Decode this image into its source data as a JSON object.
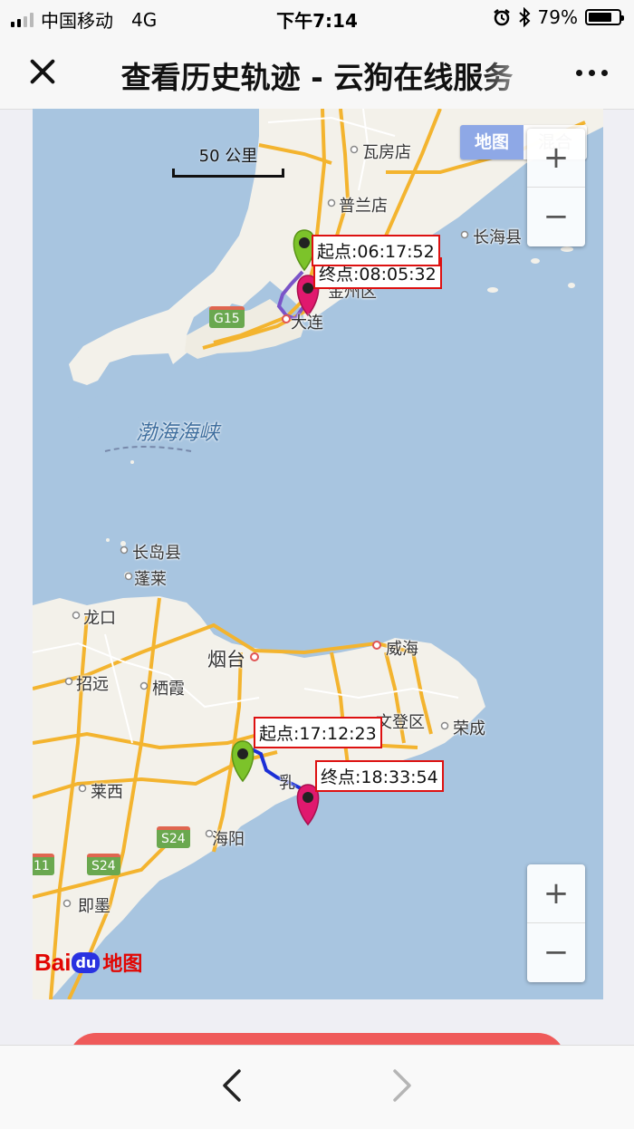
{
  "status_bar": {
    "carrier": "中国移动",
    "network": "4G",
    "time": "下午7:14",
    "battery_percent": "79%",
    "battery_level": 0.79
  },
  "title_bar": {
    "title": "查看历史轨迹 - 云狗在线服务"
  },
  "map": {
    "scale_label": "50 公里",
    "map_type": {
      "selected": "地图",
      "other": "混合"
    },
    "zoom": {
      "in": "+",
      "out": "−"
    },
    "logo": {
      "bai": "Bai",
      "du": "du",
      "suffix": "地图"
    },
    "sea_label": "渤海海峡",
    "highways": [
      "G15",
      "S24",
      "S24",
      "11"
    ],
    "places": [
      "瓦房店",
      "普兰店",
      "长海县",
      "金州区",
      "大连",
      "长岛县",
      "蓬莱",
      "龙口",
      "烟台",
      "威海",
      "招远",
      "栖霞",
      "文登区",
      "荣成",
      "莱西",
      "海阳",
      "即墨",
      "乳"
    ],
    "tracks": [
      {
        "start": "起点:06:17:52",
        "end": "终点:08:05:32"
      },
      {
        "start": "起点:17:12:23",
        "end": "终点:18:33:54"
      }
    ]
  },
  "colors": {
    "water": "#a8c5e0",
    "land": "#f3f1ea",
    "start_pin": "#7cc32a",
    "end_pin": "#e0196e",
    "label_border": "#dd1111",
    "route_dalian": "#7a54c8",
    "route_shandong": "#1b2fd6"
  },
  "icons": [
    "close-icon",
    "more-icon",
    "signal-icon",
    "alarm-icon",
    "bluetooth-icon",
    "battery-icon",
    "back-icon",
    "forward-icon"
  ]
}
